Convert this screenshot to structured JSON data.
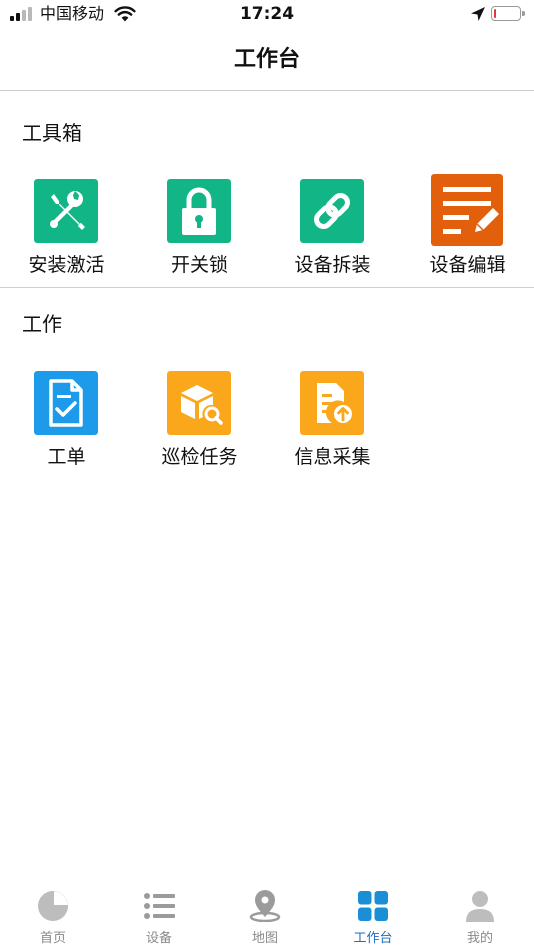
{
  "status_bar": {
    "carrier": "中国移动",
    "time": "17:24",
    "icons": [
      "signal-icon",
      "wifi-icon",
      "location-arrow-icon",
      "battery-icon"
    ]
  },
  "header": {
    "title": "工作台"
  },
  "toolbox": {
    "title": "工具箱",
    "items": [
      {
        "label": "安装激活",
        "icon": "tools-icon",
        "color": "#12b586"
      },
      {
        "label": "开关锁",
        "icon": "lock-icon",
        "color": "#12b586"
      },
      {
        "label": "设备拆装",
        "icon": "link-icon",
        "color": "#12b586"
      },
      {
        "label": "设备编辑",
        "icon": "edit-note-icon",
        "color": "#e2600c"
      }
    ]
  },
  "work": {
    "title": "工作",
    "items": [
      {
        "label": "工单",
        "icon": "work-order-icon",
        "color": "#1d9bea"
      },
      {
        "label": "巡检任务",
        "icon": "inspection-box-icon",
        "color": "#fba71c"
      },
      {
        "label": "信息采集",
        "icon": "upload-document-icon",
        "color": "#fba71c"
      }
    ]
  },
  "tab_bar": {
    "tabs": [
      {
        "label": "首页",
        "icon": "pie-chart-icon"
      },
      {
        "label": "设备",
        "icon": "list-icon"
      },
      {
        "label": "地图",
        "icon": "map-pin-icon"
      },
      {
        "label": "工作台",
        "icon": "grid-icon",
        "active": true
      },
      {
        "label": "我的",
        "icon": "user-icon"
      }
    ],
    "active_color": "#1c6fbf",
    "inactive_color": "#8a8a8a"
  }
}
